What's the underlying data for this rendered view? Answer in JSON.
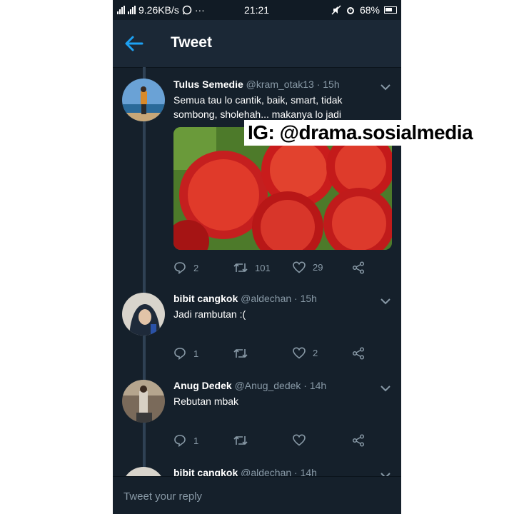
{
  "status_bar": {
    "network_speed": "9.26KB/s",
    "overflow_dots": "···",
    "time": "21:21",
    "battery": "68%"
  },
  "header": {
    "title": "Tweet"
  },
  "tweets": [
    {
      "name": "Tulus Semedie",
      "handle": "@kram_otak13 · 15h",
      "text_lines": [
        "Semua tau lo cantik, baik, smart, tidak",
        "sombong, sholehah... makanya lo jadi"
      ],
      "replies": "2",
      "retweets": "101",
      "likes": "29"
    },
    {
      "name": "bibit cangkok",
      "handle": "@aldechan · 15h",
      "text": "Jadi rambutan :(",
      "replies": "1",
      "retweets": "",
      "likes": "2"
    },
    {
      "name": "Anug Dedek",
      "handle": "@Anug_dedek · 14h",
      "text": "Rebutan mbak",
      "replies": "1",
      "retweets": "",
      "likes": ""
    },
    {
      "name": "bibit cangkok",
      "handle": "@aldechan · 14h"
    }
  ],
  "watermark": "IG: @drama.sosialmedia",
  "reply_bar": {
    "placeholder": "Tweet your reply"
  },
  "colors": {
    "background": "#15202b",
    "header": "#1b2836",
    "muted": "#8899a6",
    "accent": "#1da1f2"
  },
  "icons": [
    "signal-icon",
    "whatsapp-icon",
    "mute-icon",
    "alarm-icon",
    "battery-icon",
    "back-arrow-icon",
    "chevron-down-icon",
    "reply-icon",
    "retweet-icon",
    "like-icon",
    "share-icon"
  ]
}
